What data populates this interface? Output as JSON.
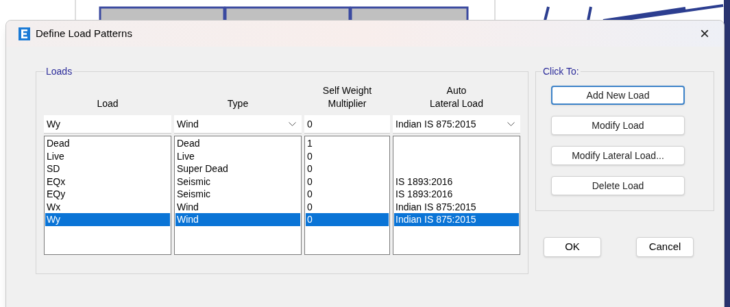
{
  "window": {
    "title": "Define Load Patterns",
    "close": "×"
  },
  "loads": {
    "group_title": "Loads",
    "headers": [
      "Load",
      "Type",
      "Self Weight\nMultiplier",
      "Auto\nLateral Load"
    ],
    "fields": [
      {
        "kind": "text",
        "value": "Wy"
      },
      {
        "kind": "dropdown",
        "value": "Wind"
      },
      {
        "kind": "text",
        "value": "0"
      },
      {
        "kind": "dropdown",
        "value": "Indian IS 875:2015"
      }
    ],
    "rows": [
      {
        "load": "Dead",
        "type": "Dead",
        "multiplier": "1",
        "auto_lateral": "",
        "selected": false
      },
      {
        "load": "Live",
        "type": "Live",
        "multiplier": "0",
        "auto_lateral": "",
        "selected": false
      },
      {
        "load": "SD",
        "type": "Super Dead",
        "multiplier": "0",
        "auto_lateral": "",
        "selected": false
      },
      {
        "load": "EQx",
        "type": "Seismic",
        "multiplier": "0",
        "auto_lateral": "IS 1893:2016",
        "selected": false
      },
      {
        "load": "EQy",
        "type": "Seismic",
        "multiplier": "0",
        "auto_lateral": "IS 1893:2016",
        "selected": false
      },
      {
        "load": "Wx",
        "type": "Wind",
        "multiplier": "0",
        "auto_lateral": "Indian IS 875:2015",
        "selected": false
      },
      {
        "load": "Wy",
        "type": "Wind",
        "multiplier": "0",
        "auto_lateral": "Indian IS 875:2015",
        "selected": true
      }
    ]
  },
  "click_to": {
    "group_title": "Click To:",
    "buttons": [
      {
        "label": "Add New Load",
        "focused": true
      },
      {
        "label": "Modify Load",
        "focused": false
      },
      {
        "label": "Modify Lateral Load...",
        "focused": false
      },
      {
        "label": "Delete Load",
        "focused": false
      }
    ]
  },
  "footer_buttons": [
    "OK",
    "Cancel"
  ]
}
